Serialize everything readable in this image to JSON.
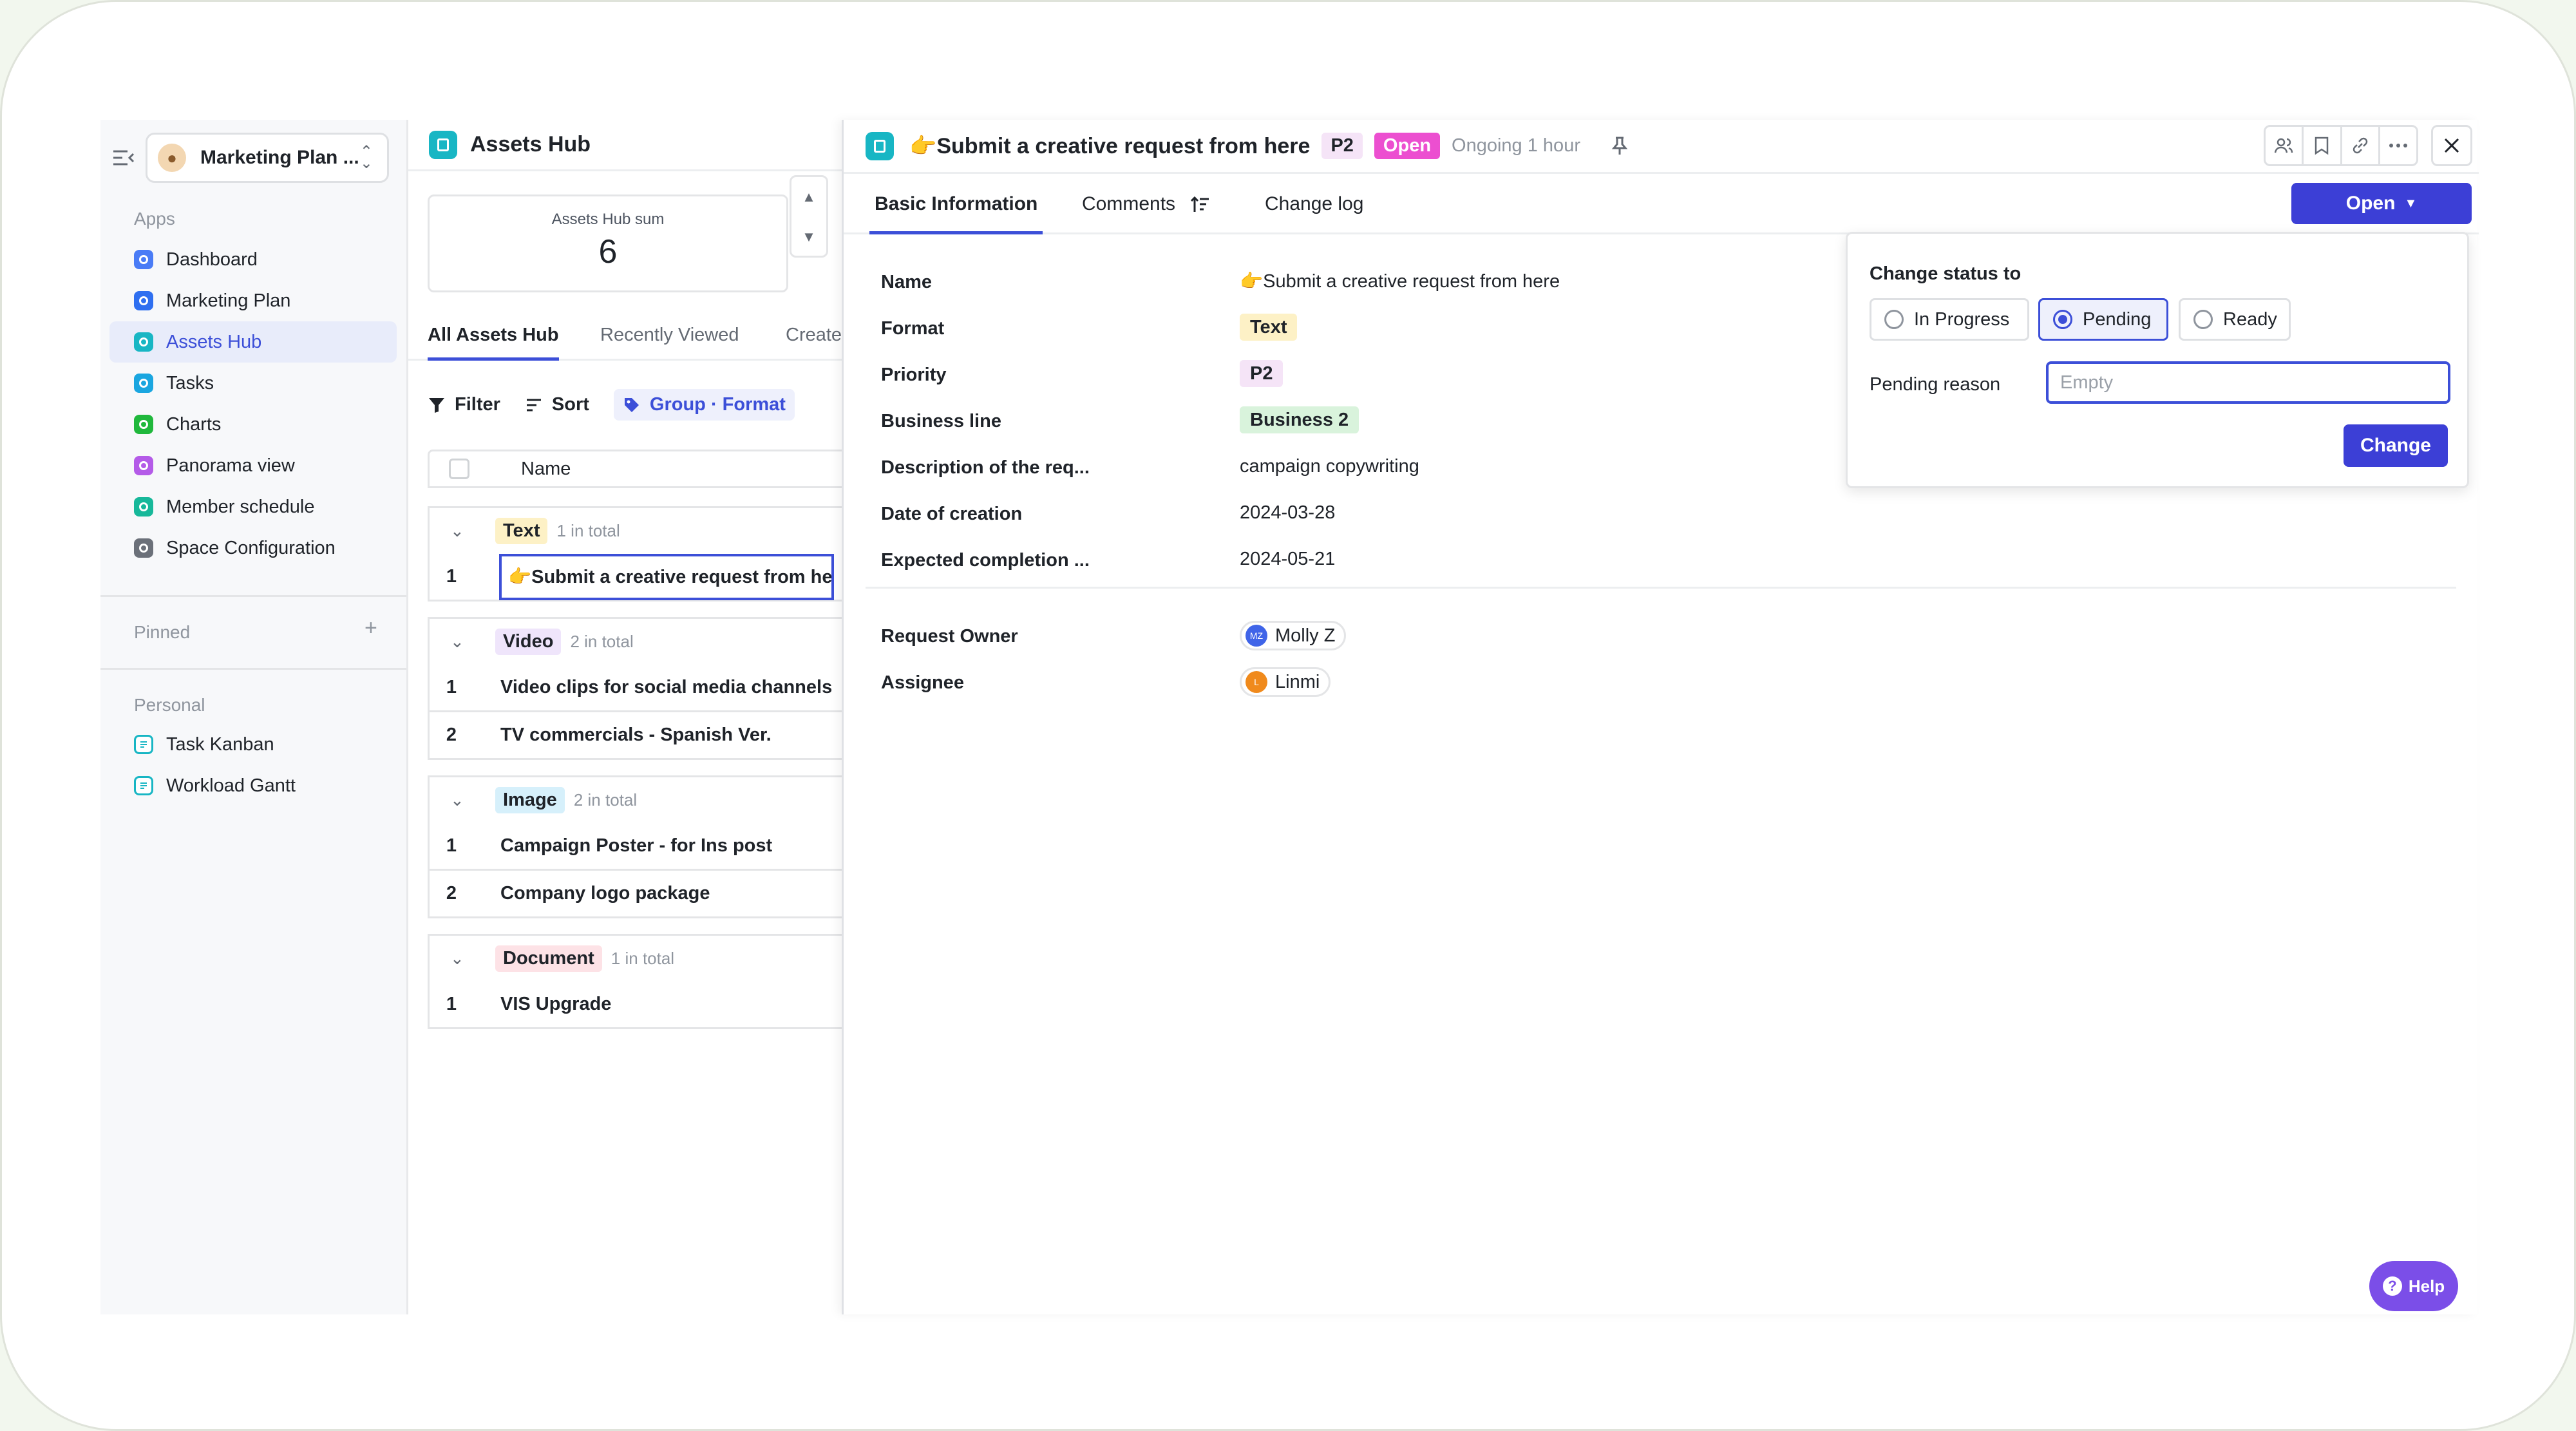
{
  "workspace": {
    "name": "Marketing Plan ...",
    "avatar_icon": "cookie-avatar"
  },
  "sidebar": {
    "apps_label": "Apps",
    "apps": [
      {
        "label": "Dashboard",
        "color": "#4a7cf6"
      },
      {
        "label": "Marketing Plan",
        "color": "#2f6ff0"
      },
      {
        "label": "Assets Hub",
        "color": "#18b6c4"
      },
      {
        "label": "Tasks",
        "color": "#1aa6e0"
      },
      {
        "label": "Charts",
        "color": "#20b83c"
      },
      {
        "label": "Panorama view",
        "color": "#b45be8"
      },
      {
        "label": "Member schedule",
        "color": "#17b89a"
      },
      {
        "label": "Space Configuration",
        "color": "#6b7079"
      }
    ],
    "active_index": 2,
    "pinned_label": "Pinned",
    "personal_label": "Personal",
    "personal": [
      {
        "label": "Task Kanban"
      },
      {
        "label": "Workload Gantt"
      }
    ]
  },
  "list": {
    "title": "Assets Hub",
    "summary_label": "Assets Hub sum",
    "summary_value": "6",
    "tabs": [
      "All Assets Hub",
      "Recently Viewed",
      "Create"
    ],
    "toolbar": {
      "filter": "Filter",
      "sort": "Sort",
      "group": "Group · Format"
    },
    "column_name": "Name",
    "groups": [
      {
        "tag": "Text",
        "tag_bg": "#fdf1c6",
        "count": "1 in total",
        "rows": [
          {
            "no": "1",
            "name": "👉Submit a creative request from here"
          }
        ]
      },
      {
        "tag": "Video",
        "tag_bg": "#efe5fb",
        "count": "2 in total",
        "rows": [
          {
            "no": "1",
            "name": "Video clips for social media channels"
          },
          {
            "no": "2",
            "name": "TV commercials - Spanish Ver."
          }
        ]
      },
      {
        "tag": "Image",
        "tag_bg": "#d6f0fb",
        "count": "2 in total",
        "rows": [
          {
            "no": "1",
            "name": "Campaign Poster - for Ins post"
          },
          {
            "no": "2",
            "name": "Company logo package"
          }
        ]
      },
      {
        "tag": "Document",
        "tag_bg": "#fde2e6",
        "count": "1 in total",
        "rows": [
          {
            "no": "1",
            "name": "VIS Upgrade"
          }
        ]
      }
    ]
  },
  "detail": {
    "title": "👉Submit a creative request from here",
    "priority_badge": "P2",
    "status_badge": "Open",
    "ongoing": "Ongoing 1 hour",
    "tabs": [
      "Basic Information",
      "Comments",
      "Change log"
    ],
    "open_button": "Open",
    "fields": [
      {
        "label": "Name",
        "value": "👉Submit a creative request from here"
      },
      {
        "label": "Format",
        "value": "Text"
      },
      {
        "label": "Priority",
        "value": "P2"
      },
      {
        "label": "Business line",
        "value": "Business 2"
      },
      {
        "label": "Description of the req...",
        "value": "campaign copywriting"
      },
      {
        "label": "Date of creation",
        "value": "2024-03-28"
      },
      {
        "label": "Expected completion ...",
        "value": "2024-05-21"
      }
    ],
    "people": [
      {
        "label": "Request Owner",
        "name": "Molly Z",
        "initials": "MZ",
        "color": "#3f64e8"
      },
      {
        "label": "Assignee",
        "name": "Linmi",
        "initials": "L",
        "color": "#f08a1c"
      }
    ]
  },
  "popover": {
    "title": "Change status to",
    "options": [
      "In Progress",
      "Pending",
      "Ready"
    ],
    "selected_index": 1,
    "reason_label": "Pending reason",
    "reason_placeholder": "Empty",
    "change_button": "Change"
  },
  "help": {
    "label": "Help"
  },
  "colors": {
    "accent": "#3c4fd8",
    "open_badge": "#ec4fd0",
    "p2_badge": "#f5e4f7"
  }
}
